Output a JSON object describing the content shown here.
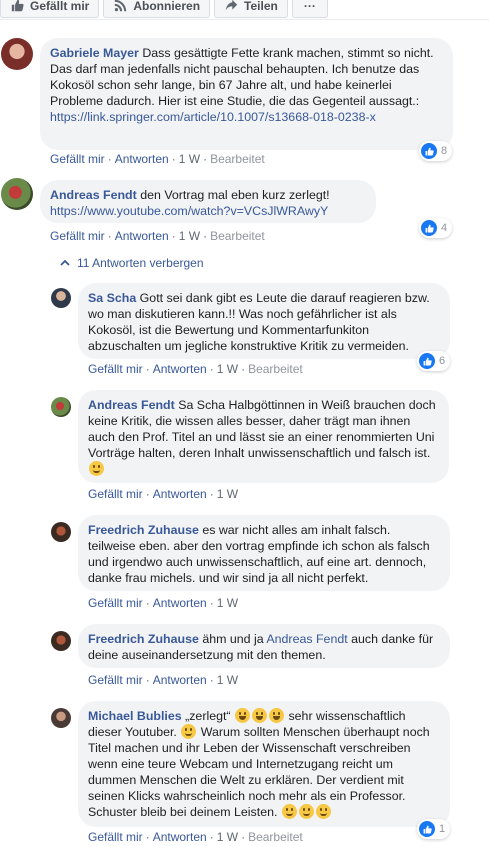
{
  "topbar": {
    "like_label": "Gefällt mir",
    "subscribe_label": "Abonnieren",
    "share_label": "Teilen",
    "more_label": "···"
  },
  "colors": {
    "link": "#385898",
    "bubble": "#f2f3f5",
    "like": "#1877f2",
    "meta": "#606770"
  },
  "comments": [
    {
      "author": "Gabriele Mayer",
      "text": "Dass gesättigte Fette krank machen, stimmt so nicht. Das darf man jedenfalls nicht pauschal behaupten. Ich benutze das Kokosöl schon sehr lange, bin 67 Jahre alt, und habe keinerlei Probleme dadurch. Hier ist eine Studie, die das Gegenteil aussagt.: ",
      "link": "https://link.springer.com/article/10.1007/s13668-018-0238-x",
      "like": "Gefällt mir",
      "reply": "Antworten",
      "time": "1 W",
      "edited": "Bearbeitet",
      "reactions": "8"
    },
    {
      "author": "Andreas Fendt",
      "text": "den Vortrag mal eben kurz zerlegt!",
      "link": "https://www.youtube.com/watch?v=VCsJlWRAwyY",
      "like": "Gefällt mir",
      "reply": "Antworten",
      "time": "1 W",
      "edited": "Bearbeitet",
      "reactions": "4"
    }
  ],
  "replies_toggle": "11 Antworten verbergen",
  "replies": [
    {
      "author": "Sa Scha",
      "text": "Gott sei dank gibt es Leute die darauf reagieren bzw. wo man diskutieren kann.!! Was noch gefährlicher ist als Kokosöl, ist die Bewertung und Kommentarfunkiton abzuschalten um jegliche konstruktive Kritik zu vermeiden.",
      "like": "Gefällt mir",
      "reply": "Antworten",
      "time": "1 W",
      "edited": "Bearbeitet",
      "reactions": "6"
    },
    {
      "author": "Andreas Fendt",
      "text": "Sa Scha Halbgöttinnen in Weiß brauchen doch keine Kritik, die wissen alles besser, daher trägt man ihnen auch den Prof. Titel an und lässt sie an einer renommierten Uni Vorträge halten, deren Inhalt unwissenschaftlich und falsch ist.",
      "like": "Gefällt mir",
      "reply": "Antworten",
      "time": "1 W"
    },
    {
      "author": "Freedrich Zuhause",
      "text": "es war nicht alles am inhalt falsch. teilweise eben. aber den vortrag empfinde ich schon als falsch und irgendwo auch unwissenschaftlich, auf eine art. dennoch, danke frau michels. und wir sind ja all nicht perfekt.",
      "like": "Gefällt mir",
      "reply": "Antworten",
      "time": "1 W"
    },
    {
      "author": "Freedrich Zuhause",
      "text_a": "ähm und ja",
      "mention": "Andreas Fendt",
      "text_b": "auch danke für deine auseinandersetzung mit den themen.",
      "like": "Gefällt mir",
      "reply": "Antworten",
      "time": "1 W"
    },
    {
      "author": "Michael Bublies",
      "text_a": "„zerlegt“",
      "text_b": "sehr wissenschaftlich dieser Youtuber.",
      "text_c": "Warum sollten Menschen überhaupt noch Titel machen und ihr Leben der Wissenschaft verschreiben wenn eine teure Webcam und Internetzugang reicht um dummen Menschen die Welt zu erklären. Der verdient mit seinen Klicks wahrscheinlich noch mehr als ein Professor. Schuster bleib bei deinem Leisten.",
      "like": "Gefällt mir",
      "reply": "Antworten",
      "time": "1 W",
      "edited": "Bearbeitet",
      "reactions": "1"
    }
  ]
}
